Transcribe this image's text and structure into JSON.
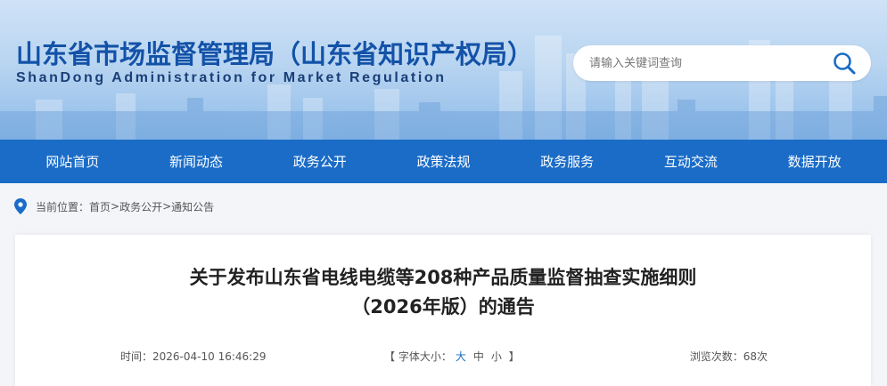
{
  "header": {
    "title": "山东省市场监督管理局（山东省知识产权局）",
    "subtitle": "ShanDong Administration for Market Regulation"
  },
  "search": {
    "placeholder": "请输入关键词查询"
  },
  "nav": {
    "items": [
      "网站首页",
      "新闻动态",
      "政务公开",
      "政策法规",
      "政务服务",
      "互动交流",
      "数据开放"
    ]
  },
  "breadcrumb": {
    "prefix": "当前位置：",
    "home": "首页",
    "sep1": ">",
    "section": "政务公开",
    "sep2": ">",
    "current": "通知公告"
  },
  "article": {
    "title_line1": "关于发布山东省电线电缆等208种产品质量监督抽查实施细则",
    "title_line2": "（2026年版）的通告",
    "time_label": "时间：",
    "time_value": "2026-04-10 16:46:29",
    "fontsize_open": "【 字体大小：",
    "size_large": "大",
    "size_medium": "中",
    "size_small": "小",
    "fontsize_close": " 】",
    "views_label": "浏览次数：",
    "views_value": "68次"
  },
  "colors": {
    "nav_bg": "#1a6cc7",
    "title_blue": "#1352a8",
    "accent": "#1a6cc7"
  }
}
